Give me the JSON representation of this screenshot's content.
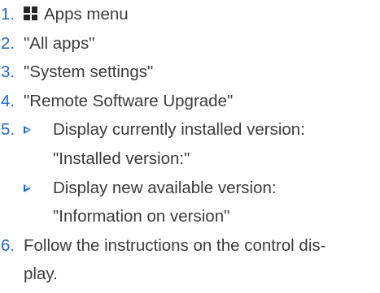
{
  "steps": [
    {
      "number": "1.",
      "icon": "apps-grid-icon",
      "text": "Apps menu"
    },
    {
      "number": "2.",
      "text": "\"All apps\""
    },
    {
      "number": "3.",
      "text": "\"System settings\""
    },
    {
      "number": "4.",
      "text": "\"Remote Software Upgrade\""
    },
    {
      "number": "5.",
      "bullets": [
        {
          "line1": "Display currently installed version:",
          "line2": "\"Installed version:\""
        },
        {
          "line1": "Display new available version:",
          "line2": "\"Information on version\""
        }
      ]
    },
    {
      "number": "6.",
      "line1": "Follow the instructions on the control dis-",
      "line2": "play."
    }
  ],
  "colors": {
    "accent": "#1c69d4",
    "text": "#3b3b3b",
    "icon": "#262626"
  }
}
